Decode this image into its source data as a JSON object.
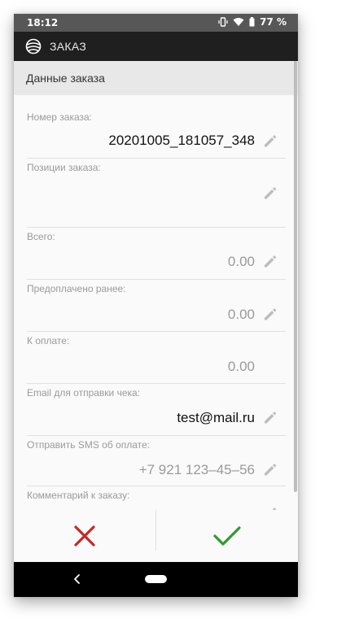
{
  "status_bar": {
    "time": "18:12",
    "battery": "77 %",
    "icons": [
      "vibrate-icon",
      "wifi-icon",
      "battery-icon"
    ]
  },
  "app_bar": {
    "title": "ЗАКАЗ",
    "logo_icon": "app-logo-icon"
  },
  "section": {
    "title": "Данные заказа"
  },
  "fields": [
    {
      "label": "Номер заказа:",
      "value": "20201005_181057_348",
      "editable": true,
      "style": "dark"
    },
    {
      "label": "Позиции заказа:",
      "value": "",
      "editable": true,
      "style": "dark"
    },
    {
      "label": "Всего:",
      "value": "0.00",
      "editable": true,
      "style": "muted"
    },
    {
      "label": "Предоплачено ранее:",
      "value": "0.00",
      "editable": true,
      "style": "muted"
    },
    {
      "label": "К оплате:",
      "value": "0.00",
      "editable": false,
      "style": "muted"
    },
    {
      "label": "Email для отправки чека:",
      "value": "test@mail.ru",
      "editable": true,
      "style": "dark"
    },
    {
      "label": "Отправить SMS об оплате:",
      "value": "+7 921 123–45–56",
      "editable": true,
      "style": "muted"
    },
    {
      "label": "Комментарий к заказу:",
      "value": "",
      "editable": true,
      "style": "muted"
    }
  ],
  "actions": {
    "cancel_icon": "close-icon",
    "confirm_icon": "checkmark-icon",
    "cancel_color": "#c62828",
    "confirm_color": "#2e9b2e"
  },
  "colors": {
    "app_bar": "#1f1f1f",
    "status_bar": "#575757",
    "section_header": "#e8e8e8",
    "label": "#9a9a9a"
  }
}
